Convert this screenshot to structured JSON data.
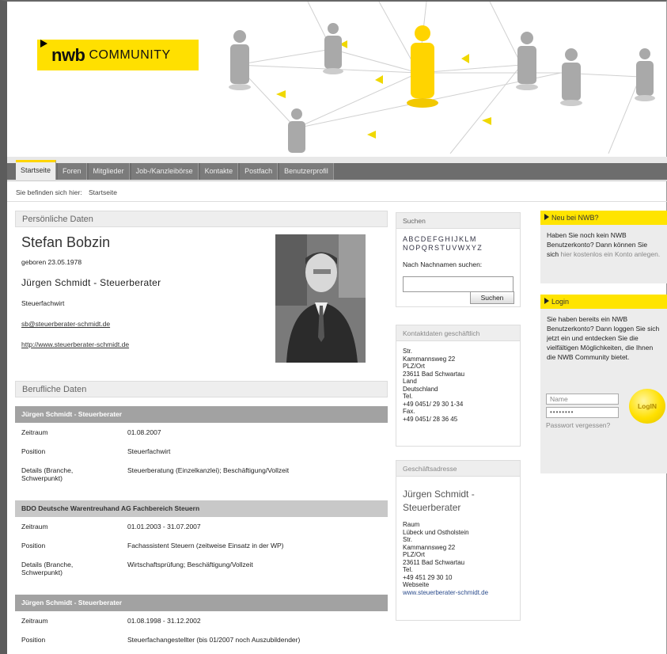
{
  "logo": {
    "bold": "nwb",
    "light": "COMMUNITY"
  },
  "nav": {
    "tabs": [
      "Startseite",
      "Foren",
      "Mitglieder",
      "Job-/Kanzleibörse",
      "Kontakte",
      "Postfach",
      "Benutzerprofil"
    ],
    "active": "Startseite"
  },
  "breadcrumb": {
    "label": "Sie befinden sich hier:",
    "current": "Startseite"
  },
  "personal": {
    "heading": "Persönliche Daten",
    "name": "Stefan Bobzin",
    "born": "geboren 23.05.1978",
    "company": "Jürgen Schmidt - Steuerberater",
    "title": "Steuerfachwirt",
    "email": "sb@steuerberater-schmidt.de",
    "web": "http://www.steuerberater-schmidt.de"
  },
  "job": {
    "heading": "Berufliche Daten",
    "entries": [
      {
        "head": "Jürgen Schmidt - Steuerberater",
        "rows": [
          {
            "k": "Zeitraum",
            "v": "01.08.2007"
          },
          {
            "k": "Position",
            "v": "Steuerfachwirt"
          },
          {
            "k": "Details (Branche, Schwerpunkt)",
            "v": "Steuerberatung (Einzelkanzlei); Beschäftigung/Vollzeit"
          }
        ]
      },
      {
        "head": "BDO Deutsche Warentreuhand AG Fachbereich Steuern",
        "rows": [
          {
            "k": "Zeitraum",
            "v": "01.01.2003 - 31.07.2007"
          },
          {
            "k": "Position",
            "v": "Fachassistent Steuern (zeitweise Einsatz in der WP)"
          },
          {
            "k": "Details (Branche, Schwerpunkt)",
            "v": "Wirtschaftsprüfung; Beschäftigung/Vollzeit"
          }
        ]
      },
      {
        "head": "Jürgen Schmidt - Steuerberater",
        "rows": [
          {
            "k": "Zeitraum",
            "v": "01.08.1998 - 31.12.2002"
          },
          {
            "k": "Position",
            "v": "Steuerfachangestellter (bis 01/2007 noch Auszubildender)"
          }
        ]
      }
    ]
  },
  "search": {
    "heading": "Suchen",
    "alpha1": "ABCDEFGHIJKLM",
    "alpha2": "NOPQRSTUVWXYZ",
    "label": "Nach Nachnamen suchen:",
    "button": "Suchen"
  },
  "kontakt": {
    "heading": "Kontaktdaten geschäftlich",
    "lines": [
      "Str.",
      "Kammannsweg 22",
      "PLZ/Ort",
      "23611 Bad Schwartau",
      "Land",
      "Deutschland",
      "Tel.",
      "+49 0451/ 29 30 1-34",
      "Fax.",
      "+49 0451/ 28 36 45"
    ]
  },
  "gesch": {
    "heading": "Geschäftsadresse",
    "name": "Jürgen Schmidt - Steuerberater",
    "lines": [
      "Raum",
      "Lübeck und Ostholstein",
      "Str.",
      "Kammannsweg 22",
      "PLZ/Ort",
      "23611 Bad Schwartau",
      "Tel.",
      "+49 451 29 30 10",
      "Webseite"
    ],
    "web": "www.steuerberater-schmidt.de"
  },
  "neu": {
    "heading": "Neu bei NWB?",
    "text": "Haben Sie noch kein NWB Benutzerkonto? Dann können Sie sich",
    "link": "hier kostenlos ein Konto anlegen."
  },
  "login": {
    "heading": "Login",
    "text": "Sie haben bereits ein NWB Benutzerkonto? Dann loggen Sie sich jetzt ein und entdecken Sie die vielfältigen Möglichkeiten, die Ihnen die NWB Community bietet.",
    "name_placeholder": "Name",
    "password_mask": "••••••••",
    "button": "LogIN",
    "forgot": "Passwort vergessen?"
  }
}
